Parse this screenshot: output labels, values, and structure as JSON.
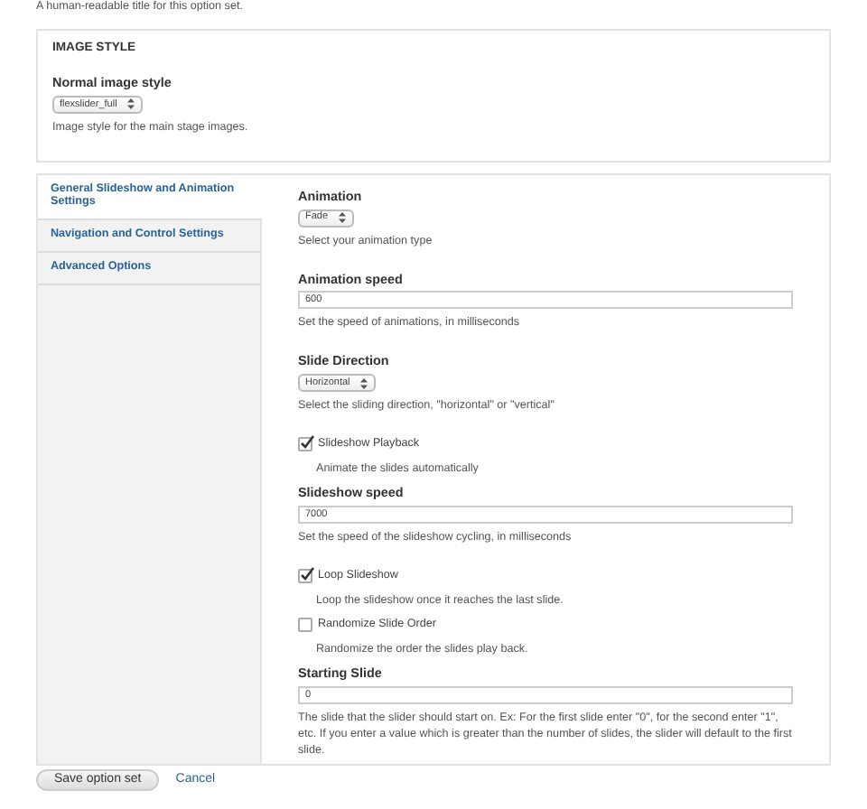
{
  "intro_hint": "A human-readable title for this option set.",
  "image_style": {
    "legend": "IMAGE STYLE",
    "label": "Normal image style",
    "value": "flexslider_full",
    "description": "Image style for the main stage images."
  },
  "tabs": [
    {
      "label": "General Slideshow and Animation Settings",
      "selected": true
    },
    {
      "label": "Navigation and Control Settings",
      "selected": false
    },
    {
      "label": "Advanced Options",
      "selected": false
    }
  ],
  "fields": [
    {
      "kind": "select",
      "label": "Animation",
      "value": "Fade",
      "description": "Select your animation type"
    },
    {
      "kind": "text",
      "label": "Animation speed",
      "value": "600",
      "description": "Set the speed of animations, in milliseconds"
    },
    {
      "kind": "select",
      "label": "Slide Direction",
      "value": "Horizontal",
      "description": "Select the sliding direction, \"horizontal\" or \"vertical\""
    },
    {
      "kind": "checkbox",
      "label": "Slideshow Playback",
      "checked": true,
      "description": "Animate the slides automatically"
    },
    {
      "kind": "text",
      "label": "Slideshow speed",
      "value": "7000",
      "description": "Set the speed of the slideshow cycling, in milliseconds"
    },
    {
      "kind": "checkbox",
      "label": "Loop Slideshow",
      "checked": true,
      "description": "Loop the slideshow once it reaches the last slide."
    },
    {
      "kind": "checkbox",
      "label": "Randomize Slide Order",
      "checked": false,
      "description": "Randomize the order the slides play back."
    },
    {
      "kind": "text",
      "label": "Starting Slide",
      "value": "0",
      "description": "The slide that the slider should start on. Ex: For the first slide enter \"0\", for the second enter \"1\", etc. If you enter a value which is greater than the number of slides, the slider will default to the first slide."
    }
  ],
  "actions": {
    "save": "Save option set",
    "cancel": "Cancel"
  }
}
